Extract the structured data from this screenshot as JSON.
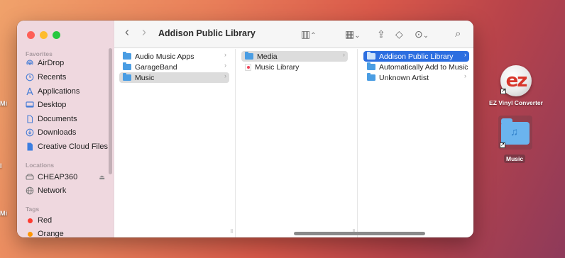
{
  "desktop": {
    "edge_labels": [
      "Mi",
      "l",
      "Mi"
    ],
    "icons": [
      {
        "label": "EZ Vinyl Converter",
        "glyph": "ez"
      },
      {
        "label": "Music",
        "glyph": "♫"
      }
    ]
  },
  "window": {
    "title": "Addison Public Library",
    "toolbar": {
      "back_glyph": "‹",
      "forward_glyph": "›",
      "view_glyph": "▥",
      "view_chevron": "⌃",
      "group_glyph": "▦",
      "group_chevron": "⌄",
      "share_glyph": "⇪",
      "tag_glyph": "◇",
      "more_glyph": "⊙",
      "more_chevron": "⌄",
      "search_glyph": "⌕"
    },
    "sidebar": {
      "favorites_header": "Favorites",
      "favorites": [
        {
          "label": "AirDrop",
          "icon": "airdrop-icon"
        },
        {
          "label": "Recents",
          "icon": "clock-icon"
        },
        {
          "label": "Applications",
          "icon": "applications-icon"
        },
        {
          "label": "Desktop",
          "icon": "desktop-icon"
        },
        {
          "label": "Documents",
          "icon": "document-icon"
        },
        {
          "label": "Downloads",
          "icon": "download-icon"
        },
        {
          "label": "Creative Cloud Files",
          "icon": "file-icon"
        }
      ],
      "locations_header": "Locations",
      "locations": [
        {
          "label": "CHEAP360",
          "icon": "drive-icon",
          "eject": "⏏"
        },
        {
          "label": "Network",
          "icon": "globe-icon"
        }
      ],
      "tags_header": "Tags",
      "tags": [
        {
          "label": "Red",
          "color": "#fe3b30"
        },
        {
          "label": "Orange",
          "color": "#fe9500"
        }
      ]
    },
    "columns": [
      {
        "rows": [
          {
            "label": "Audio Music Apps",
            "icon": "folder-icon",
            "has_children": true
          },
          {
            "label": "GarageBand",
            "icon": "folder-icon",
            "has_children": true
          },
          {
            "label": "Music",
            "icon": "folder-icon",
            "has_children": true,
            "selected": "grey"
          }
        ]
      },
      {
        "rows": [
          {
            "label": "Media",
            "icon": "folder-icon",
            "has_children": true,
            "selected": "grey"
          },
          {
            "label": "Music Library",
            "icon": "music-library-icon",
            "has_children": false
          }
        ]
      },
      {
        "rows": [
          {
            "label": "Addison Public Library",
            "icon": "folder-icon",
            "has_children": true,
            "selected": "blue"
          },
          {
            "label": "Automatically Add to Music",
            "icon": "folder-icon",
            "has_children": true
          },
          {
            "label": "Unknown Artist",
            "icon": "folder-icon",
            "has_children": true
          }
        ]
      }
    ],
    "column_resize_glyph": "ll",
    "chevron_glyph": "›"
  }
}
